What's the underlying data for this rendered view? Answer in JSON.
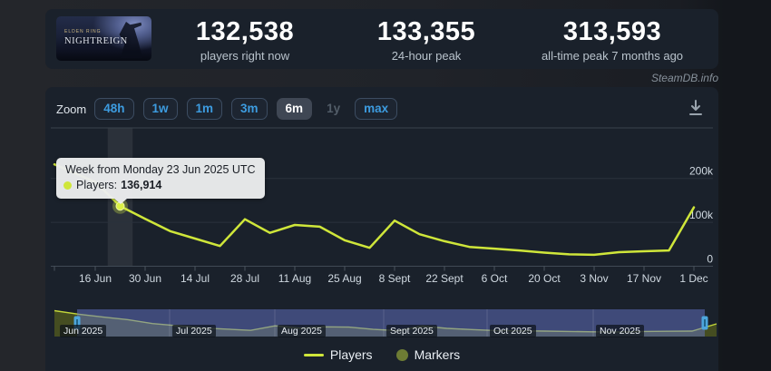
{
  "page": {
    "watermark": "SteamDB.info"
  },
  "header": {
    "game": {
      "line1": "ELDEN RING",
      "line2": "NIGHTREIGN"
    },
    "stats": [
      {
        "value": "132,538",
        "label": "players right now"
      },
      {
        "value": "133,355",
        "label": "24-hour peak"
      },
      {
        "value": "313,593",
        "label": "all-time peak 7 months ago"
      }
    ]
  },
  "toolbar": {
    "zoom_label": "Zoom",
    "buttons": [
      {
        "label": "48h",
        "state": "normal"
      },
      {
        "label": "1w",
        "state": "normal"
      },
      {
        "label": "1m",
        "state": "normal"
      },
      {
        "label": "3m",
        "state": "normal"
      },
      {
        "label": "6m",
        "state": "selected"
      },
      {
        "label": "1y",
        "state": "disabled"
      },
      {
        "label": "max",
        "state": "normal"
      }
    ],
    "download_icon": "download-icon"
  },
  "tooltip": {
    "title": "Week from Monday 23 Jun 2025 UTC",
    "series_label": "Players:",
    "value": "136,914"
  },
  "legend": [
    {
      "label": "Players",
      "swatch": "line"
    },
    {
      "label": "Markers",
      "swatch": "circle"
    }
  ],
  "chart_data": {
    "type": "line",
    "title": "",
    "xlabel": "",
    "ylabel": "",
    "ylim": [
      0,
      300000
    ],
    "grid": true,
    "y_tick_labels": [
      "200k",
      "100k",
      "0"
    ],
    "y_tick_values_k": [
      200,
      100,
      0
    ],
    "x_tick_labels": [
      "16 Jun",
      "30 Jun",
      "14 Jul",
      "28 Jul",
      "11 Aug",
      "25 Aug",
      "8 Sept",
      "22 Sept",
      "6 Oct",
      "20 Oct",
      "3 Nov",
      "17 Nov",
      "1 Dec"
    ],
    "series": [
      {
        "name": "Players",
        "cadence": "weekly",
        "first_point": "16 Jun 2025",
        "last_point": "1 Dec 2025",
        "values_k": [
          192,
          136.914,
          108,
          80,
          63,
          46,
          107,
          76,
          94,
          90,
          59,
          42,
          104,
          73,
          57,
          44,
          40,
          36,
          31,
          27,
          26,
          32,
          34,
          36,
          134
        ],
        "left_edge_clip_value_k": 232
      }
    ],
    "hover_point": {
      "index": 1,
      "x_label": "23 Jun 2025",
      "value": 136914
    },
    "navigator": {
      "month_labels": [
        "Jun 2025",
        "Jul 2025",
        "Aug 2025",
        "Sept 2025",
        "Oct 2025",
        "Nov 2025"
      ],
      "values_k": [
        310,
        262,
        224,
        190,
        137,
        108,
        80,
        63,
        46,
        107,
        76,
        94,
        90,
        59,
        42,
        104,
        73,
        57,
        44,
        40,
        36,
        31,
        27,
        26,
        32,
        34,
        36,
        134
      ]
    },
    "colors": {
      "line": "#cfe63a",
      "marker": "#dcf145",
      "marker_legend": "#6d7c34",
      "grid": "#2a323c",
      "axis": "#404954",
      "hover_band": "rgba(255,255,255,0.075)",
      "navigator_mask": "rgba(100,116,200,0.5)",
      "navigator_fill": "#4e5520",
      "handle": "#4da6dd",
      "label_text": "#d0d9e1"
    }
  }
}
